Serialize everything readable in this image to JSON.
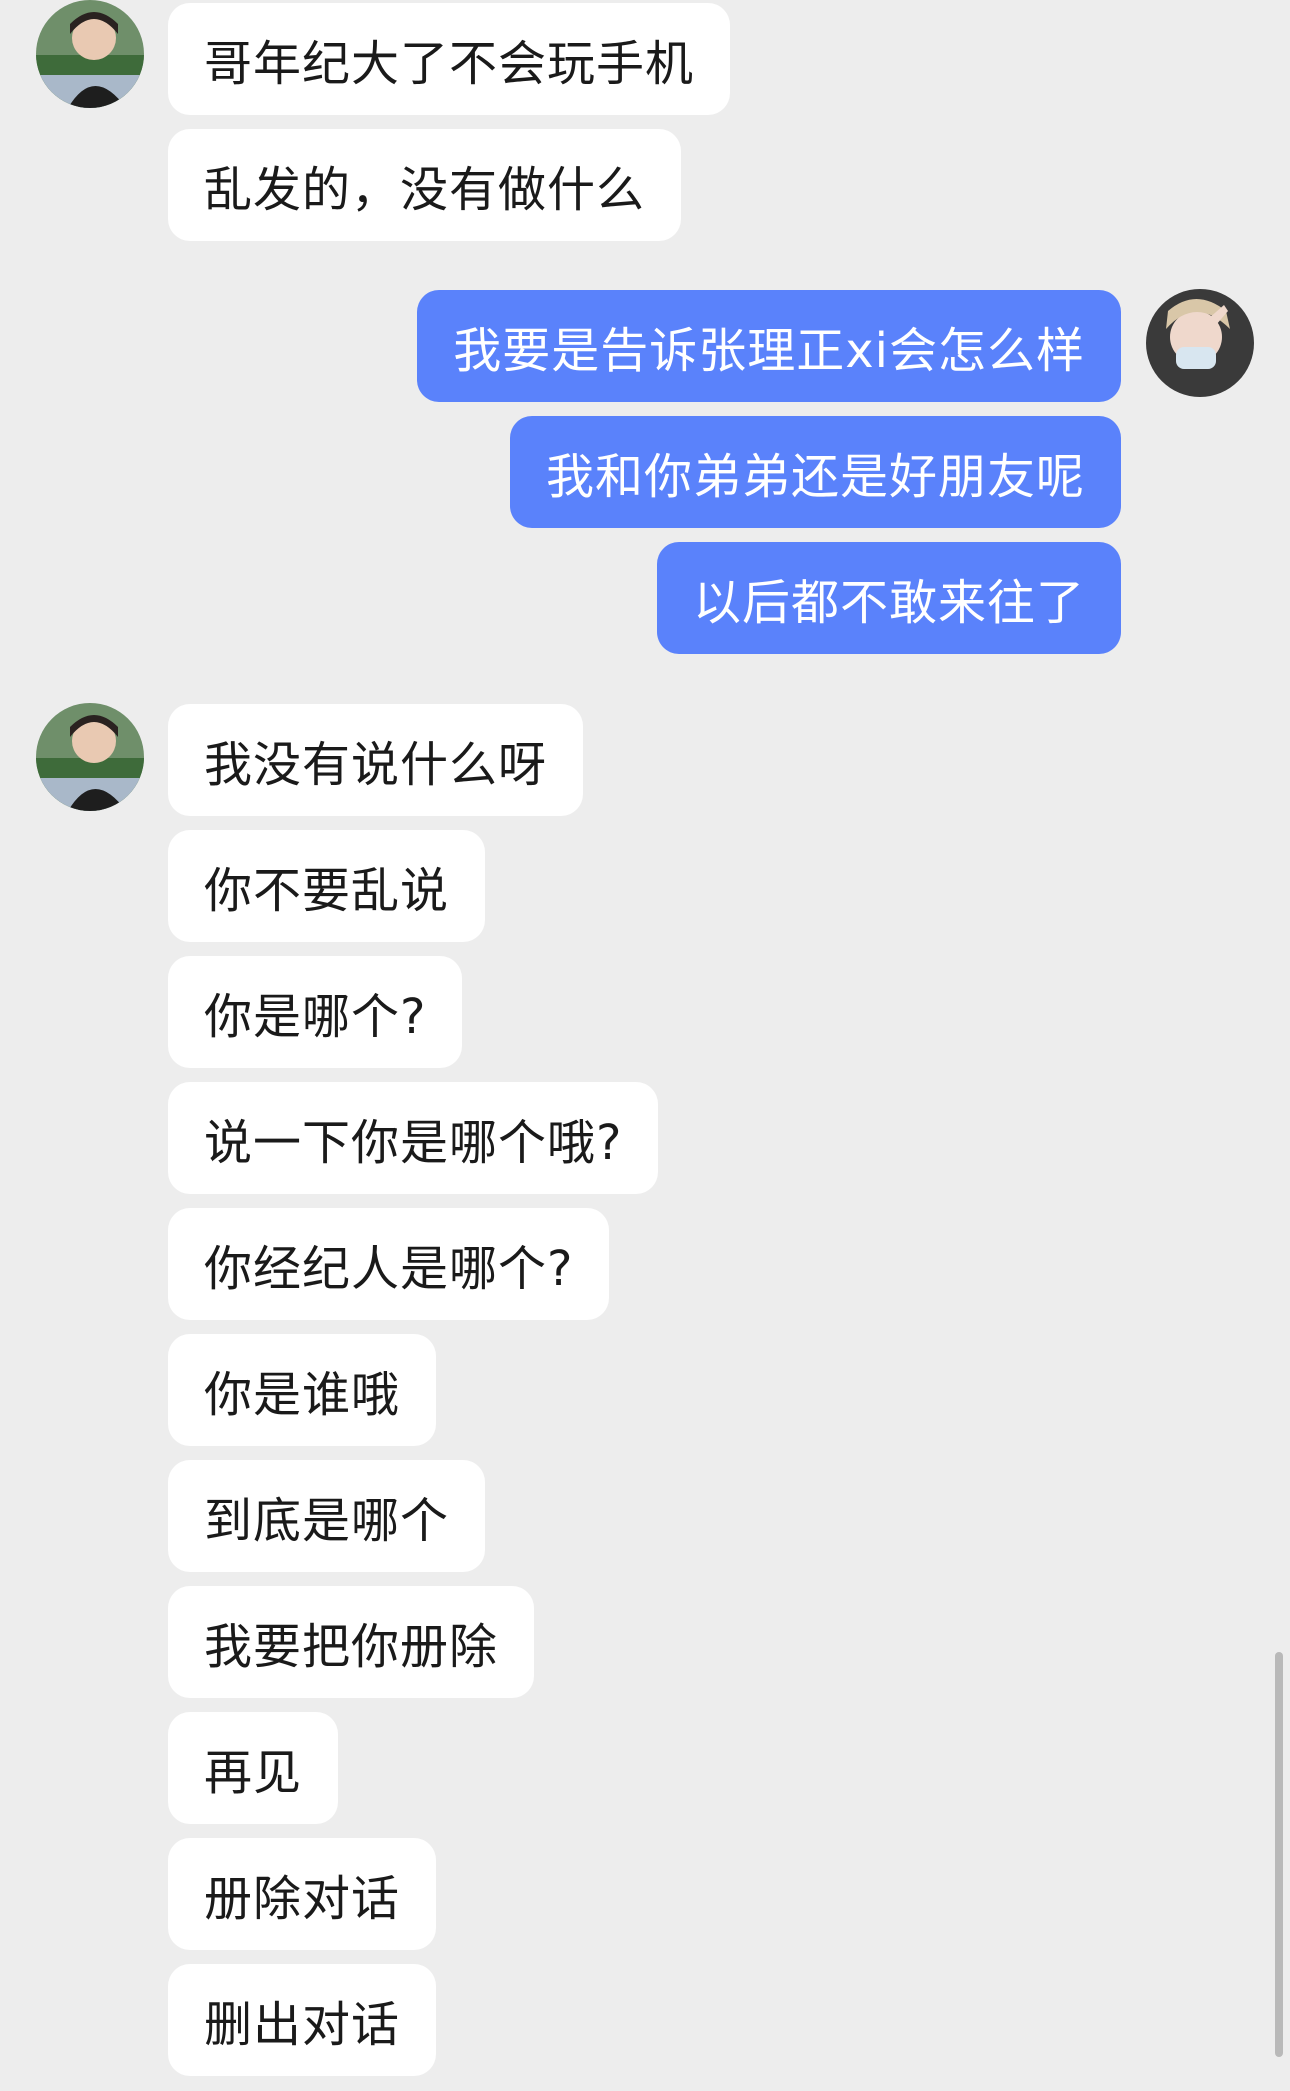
{
  "theme": {
    "background": "#EDEDED",
    "incoming_bubble": "#FFFFFF",
    "outgoing_bubble": "#5A82FB"
  },
  "contact": {
    "avatar_icon": "contact-avatar"
  },
  "me": {
    "avatar_icon": "my-avatar"
  },
  "messages": [
    {
      "side": "in",
      "text": "哥年纪大了不会玩手机"
    },
    {
      "side": "in",
      "text": "乱发的，没有做什么"
    },
    {
      "side": "out",
      "text": "我要是告诉张理正xi会怎么样"
    },
    {
      "side": "out",
      "text": "我和你弟弟还是好朋友呢"
    },
    {
      "side": "out",
      "text": "以后都不敢来往了"
    },
    {
      "side": "in",
      "text": "我没有说什么呀"
    },
    {
      "side": "in",
      "text": "你不要乱说"
    },
    {
      "side": "in",
      "text": "你是哪个?"
    },
    {
      "side": "in",
      "text": "说一下你是哪个哦?"
    },
    {
      "side": "in",
      "text": "你经纪人是哪个?"
    },
    {
      "side": "in",
      "text": "你是谁哦"
    },
    {
      "side": "in",
      "text": "到底是哪个"
    },
    {
      "side": "in",
      "text": "我要把你册除"
    },
    {
      "side": "in",
      "text": "再见"
    },
    {
      "side": "in",
      "text": "册除对话"
    },
    {
      "side": "in",
      "text": "删出对话"
    }
  ]
}
